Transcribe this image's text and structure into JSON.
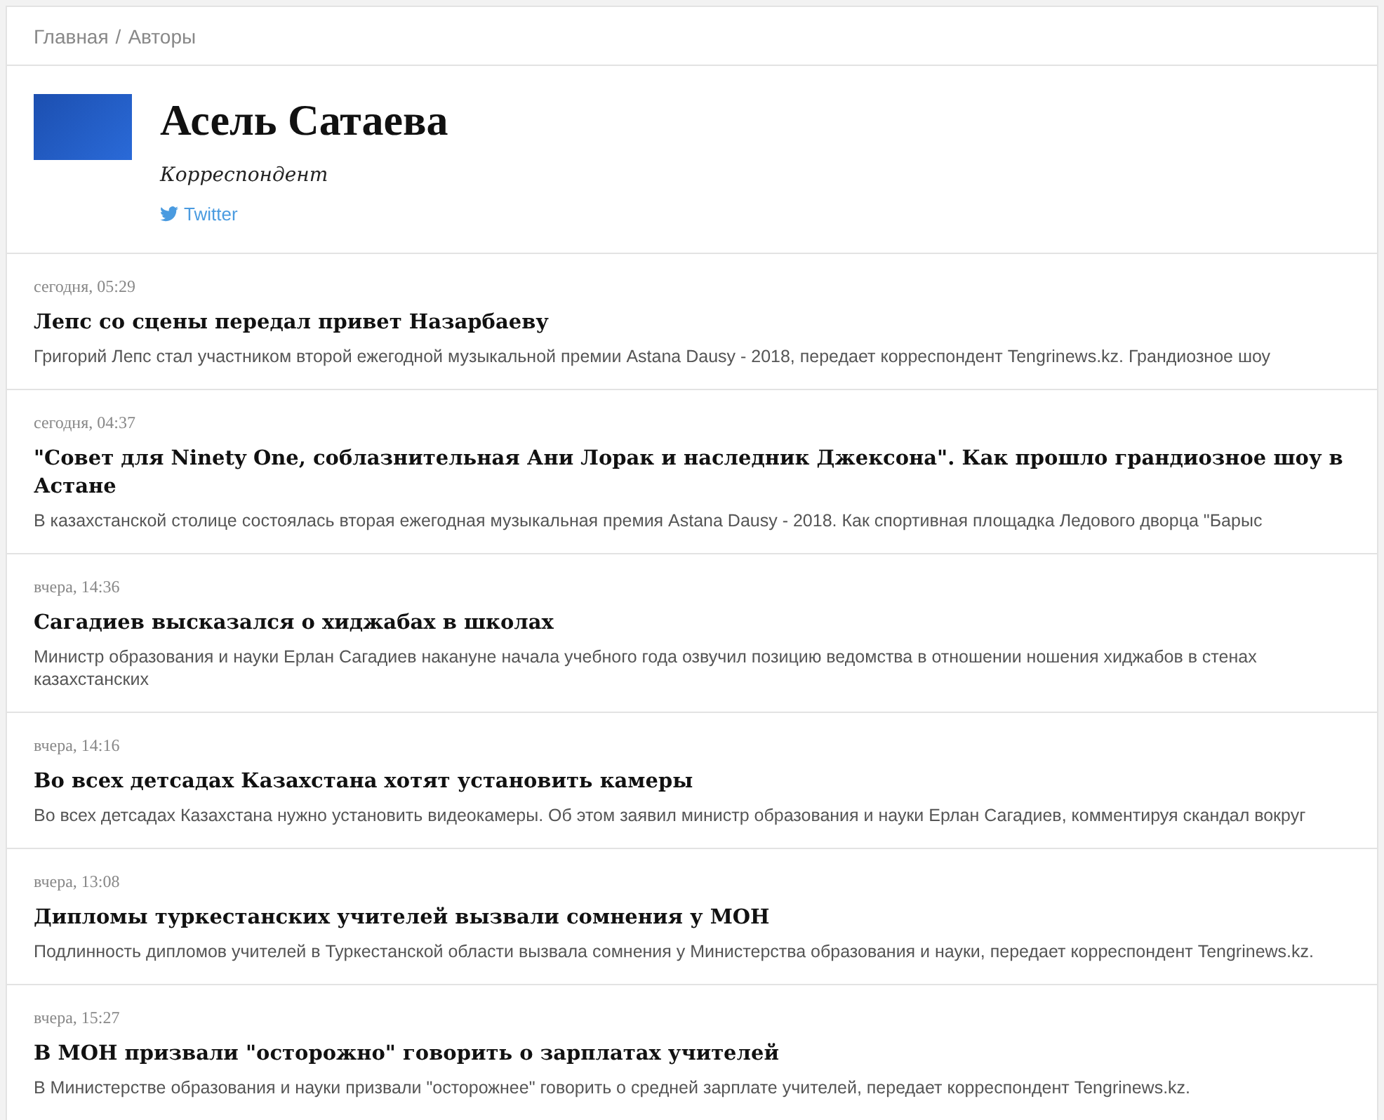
{
  "breadcrumb": {
    "items": [
      "Главная",
      "Авторы"
    ],
    "separator": "/"
  },
  "author": {
    "name": "Асель Сатаева",
    "role": "Корреспондент",
    "social_link": "Twitter"
  },
  "articles": [
    {
      "date": "сегодня, 05:29",
      "title": "Лепс со сцены передал привет Назарбаеву",
      "summary": "Григорий Лепс стал участником второй ежегодной музыкальной премии Astana Dausy - 2018, передает корреспондент Tengrinews.kz. Грандиозное шоу"
    },
    {
      "date": "сегодня, 04:37",
      "title": "\"Совет для Ninety One, соблазнительная Ани Лорак и наследник Джексона\". Как прошло грандиозное шоу в Астане",
      "summary": "В казахстанской столице состоялась вторая ежегодная музыкальная премия Astana Dausy - 2018. Как спортивная площадка Ледового дворца \"Барыс"
    },
    {
      "date": "вчера, 14:36",
      "title": "Сагадиев высказался о хиджабах в школах",
      "summary": "Министр образования и науки Ерлан Сагадиев накануне начала учебного года озвучил позицию ведомства в отношении ношения хиджабов в стенах казахстанских"
    },
    {
      "date": "вчера, 14:16",
      "title": "Во всех детсадах Казахстана хотят установить камеры",
      "summary": "Во всех детсадах Казахстана нужно установить видеокамеры. Об этом заявил министр образования и науки Ерлан Сагадиев, комментируя скандал вокруг"
    },
    {
      "date": "вчера, 13:08",
      "title": "Дипломы туркестанских учителей вызвали сомнения у МОН",
      "summary": "Подлинность дипломов учителей в Туркестанской области вызвала сомнения у Министерства образования и науки, передает корреспондент Tengrinews.kz."
    },
    {
      "date": "вчера, 15:27",
      "title": "В МОН призвали \"осторожно\" говорить о зарплатах учителей",
      "summary": "В Министерстве образования и науки призвали \"осторожнее\" говорить о средней зарплате учителей, передает корреспондент Tengrinews.kz."
    }
  ]
}
